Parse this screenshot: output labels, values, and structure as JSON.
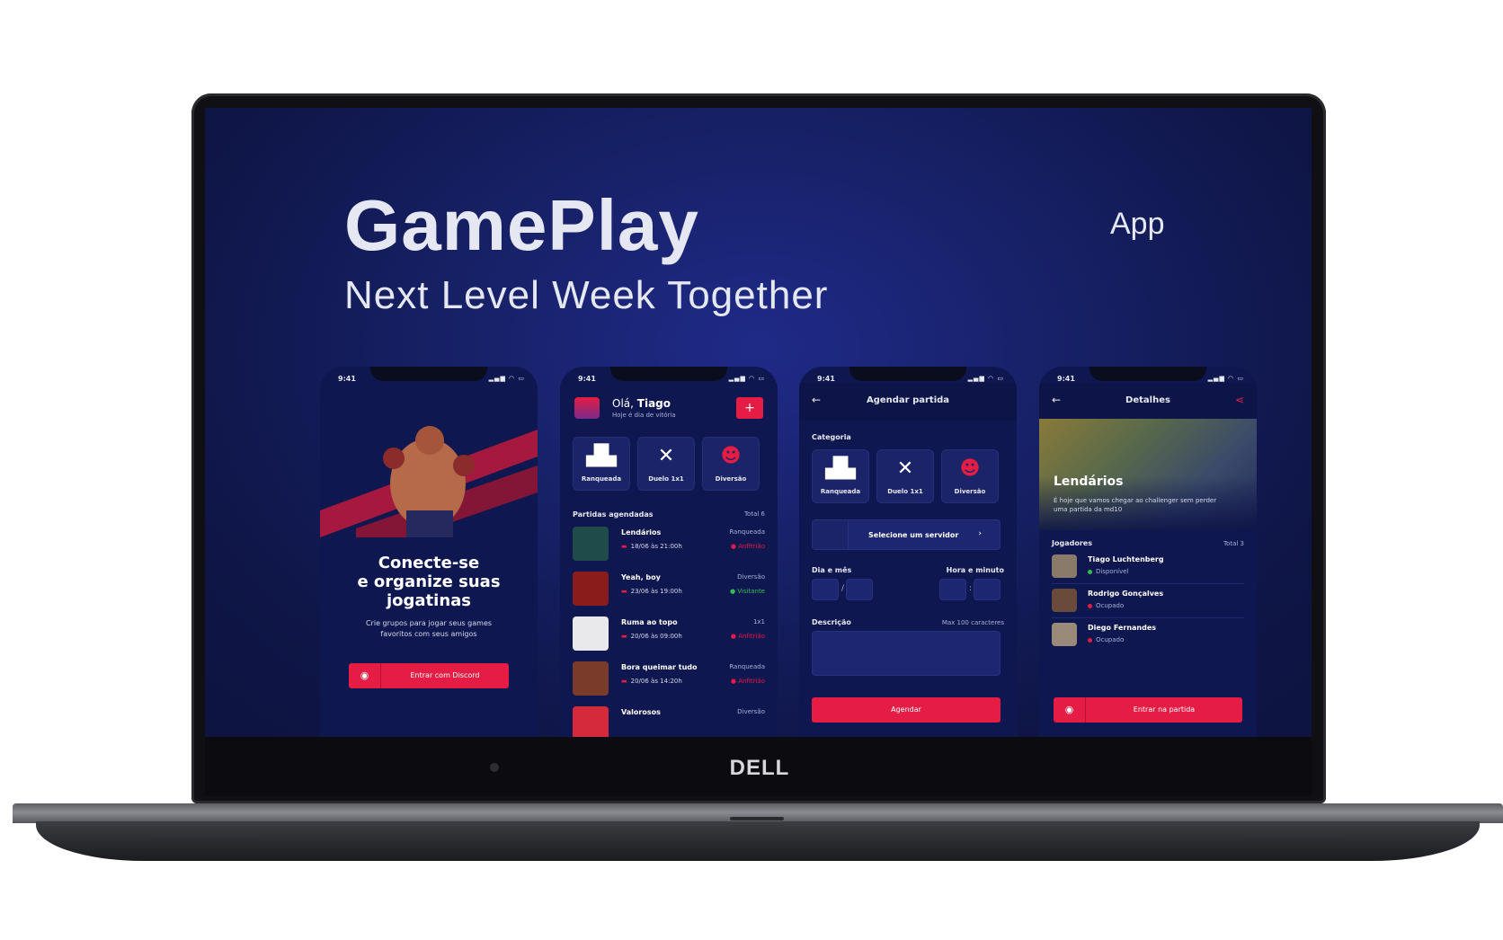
{
  "hero": {
    "title": "GamePlay",
    "subtitle": "Next Level Week Together",
    "tag": "App"
  },
  "laptop": {
    "brand": "DELL"
  },
  "status_time": "9:41",
  "status_icons": "▂▄▆ ◠ ▭",
  "phone1": {
    "headline1": "Conecte-se",
    "headline2": "e organize suas",
    "headline3": "jogatinas",
    "body": "Crie grupos para jogar seus games favoritos com seus amigos",
    "button": "Entrar com Discord"
  },
  "phone2": {
    "greeting_prefix": "Olá,",
    "greeting_name": "Tiago",
    "greeting_sub": "Hoje é dia de vitória",
    "add": "+",
    "categories": [
      {
        "label": "Ranqueada",
        "icon": "podium-icon"
      },
      {
        "label": "Duelo 1x1",
        "icon": "crossed-swords-icon"
      },
      {
        "label": "Diversão",
        "icon": "party-face-icon"
      }
    ],
    "section_title": "Partidas agendadas",
    "section_total": "Total 6",
    "matches": [
      {
        "name": "Lendários",
        "category": "Ranqueada",
        "date": "18/06 às 21:00h",
        "role": "Anfitrião",
        "role_type": "host"
      },
      {
        "name": "Yeah, boy",
        "category": "Diversão",
        "date": "23/06 às 19:00h",
        "role": "Visitante",
        "role_type": "guest"
      },
      {
        "name": "Ruma ao topo",
        "category": "1x1",
        "date": "20/06 às 09:00h",
        "role": "Anfitrião",
        "role_type": "host"
      },
      {
        "name": "Bora queimar tudo",
        "category": "Ranqueada",
        "date": "20/06 às 14:20h",
        "role": "Anfitrião",
        "role_type": "host"
      },
      {
        "name": "Valorosos",
        "category": "Diversão",
        "date": "",
        "role": "",
        "role_type": "host"
      }
    ]
  },
  "phone3": {
    "header": "Agendar partida",
    "category_label": "Categoria",
    "categories": [
      "Ranqueada",
      "Duelo 1x1",
      "Diversão"
    ],
    "server_select": "Selecione um servidor",
    "date_label": "Dia e mês",
    "time_label": "Hora e minuto",
    "date_sep": "/",
    "time_sep": ":",
    "desc_label": "Descrição",
    "desc_limit": "Max 100 caracteres",
    "submit": "Agendar"
  },
  "phone4": {
    "header": "Detalhes",
    "banner_title": "Lendários",
    "banner_desc": "É hoje que vamos chegar ao challenger sem perder uma partida da md10",
    "players_label": "Jogadores",
    "players_total": "Total 3",
    "players": [
      {
        "name": "Tiago Luchtenberg",
        "status": "Disponível",
        "status_color": "#32bd50"
      },
      {
        "name": "Rodrigo Gonçalves",
        "status": "Ocupado",
        "status_color": "#e51c44"
      },
      {
        "name": "Diego Fernandes",
        "status": "Ocupado",
        "status_color": "#e51c44"
      }
    ],
    "button": "Entrar na partida"
  },
  "colors": {
    "accent": "#e51c44",
    "background": "#0f1750",
    "card": "#1b2468",
    "text": "#e6e8f0"
  }
}
